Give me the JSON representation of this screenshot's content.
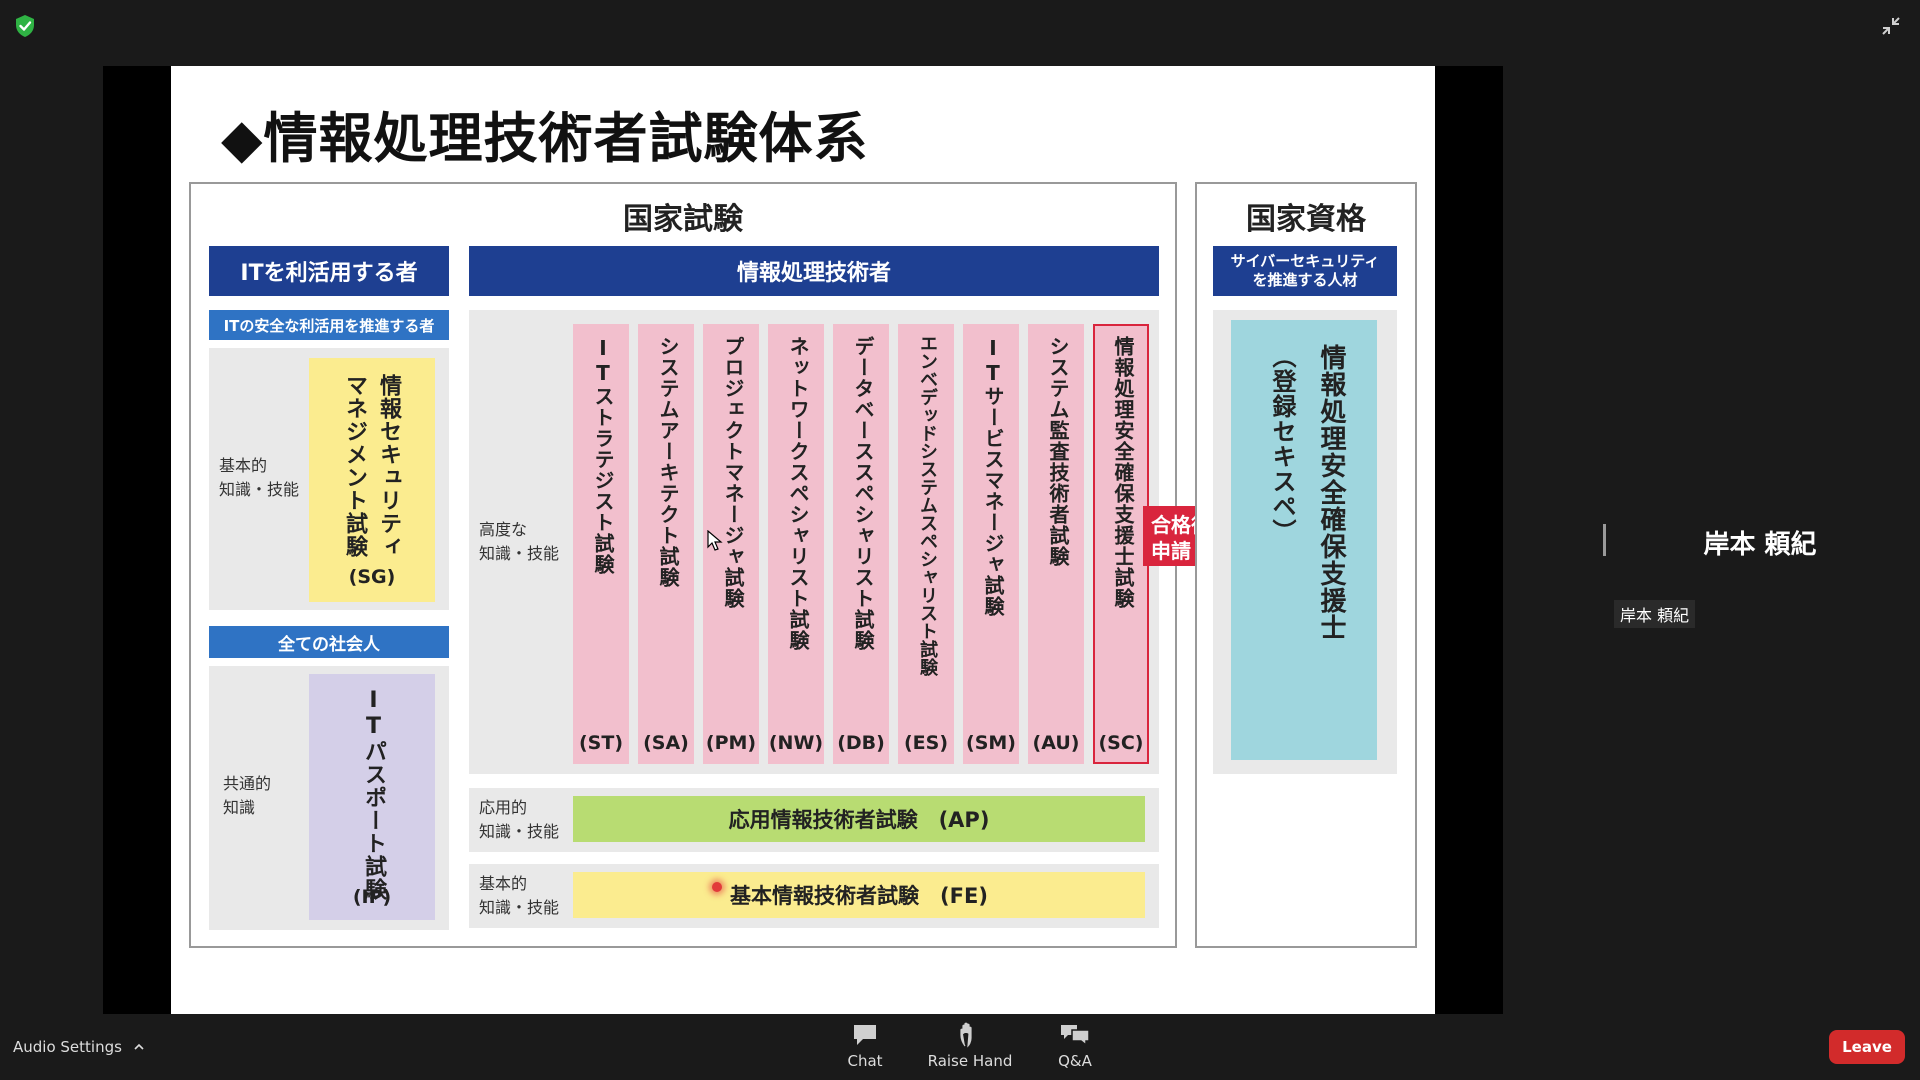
{
  "slide": {
    "title": "◆情報処理技術者試験体系",
    "national_exam": "国家試験",
    "national_qualification": "国家資格",
    "it_users_header": "ITを利活用する者",
    "it_pros_header": "情報処理技術者",
    "cyber_header_line1": "サイバーセキュリティ",
    "cyber_header_line2": "を推進する人材",
    "safe_use_header": "ITの安全な利活用を推進する者",
    "basic_label": "基本的\n知識・技能",
    "sg_name": "情報セキュリティマネジメント試験",
    "sg_code": "(SG)",
    "all_workers_header": "全ての社会人",
    "common_label": "共通的\n知識",
    "ip_name": "ITパスポート試験",
    "ip_code": "(IP)",
    "advanced_label": "高度な\n知識・技能",
    "exams": [
      {
        "name": "ITストラテジスト試験",
        "code": "(ST)"
      },
      {
        "name": "システムアーキテクト試験",
        "code": "(SA)"
      },
      {
        "name": "プロジェクトマネージャ試験",
        "code": "(PM)"
      },
      {
        "name": "ネットワークスペシャリスト試験",
        "code": "(NW)"
      },
      {
        "name": "データベーススペシャリスト試験",
        "code": "(DB)"
      },
      {
        "name": "エンベデッドシステムスペシャリスト試験",
        "code": "(ES)"
      },
      {
        "name": "ITサービスマネージャ試験",
        "code": "(SM)"
      },
      {
        "name": "システム監査技術者試験",
        "code": "(AU)"
      },
      {
        "name": "情報処理安全確保支援士試験",
        "code": "(SC)"
      }
    ],
    "pass_arrow": "合格後\n申請",
    "applied_label": "応用的\n知識・技能",
    "ap_exam": "応用情報技術者試験　(AP)",
    "fe_label": "基本的\n知識・技能",
    "fe_exam": "基本情報技術者試験　(FE)",
    "registered_sub": "（登録セキスペ）",
    "registered_name": "情報処理安全確保支援士"
  },
  "participant": {
    "name": "岸本 頼紀",
    "name_tag": "岸本 頼紀"
  },
  "toolbar": {
    "audio_settings": "Audio Settings",
    "chat": "Chat",
    "raise_hand": "Raise Hand",
    "qa": "Q&A",
    "leave": "Leave"
  },
  "colors": {
    "navy": "#1e3f91",
    "blue": "#2f73c4",
    "pink": "#f2bfcd",
    "yellow": "#fbec8f",
    "lavender": "#d4cfe8",
    "green": "#b8dc72",
    "cyan": "#9fd6de",
    "arrow_red": "#d9253d",
    "leave_red": "#d22b2b"
  },
  "icons": [
    "shield-check-icon",
    "exit-fullscreen-icon",
    "chevron-up-icon",
    "chat-icon",
    "raise-hand-icon",
    "qa-icon",
    "mouse-cursor-icon"
  ]
}
